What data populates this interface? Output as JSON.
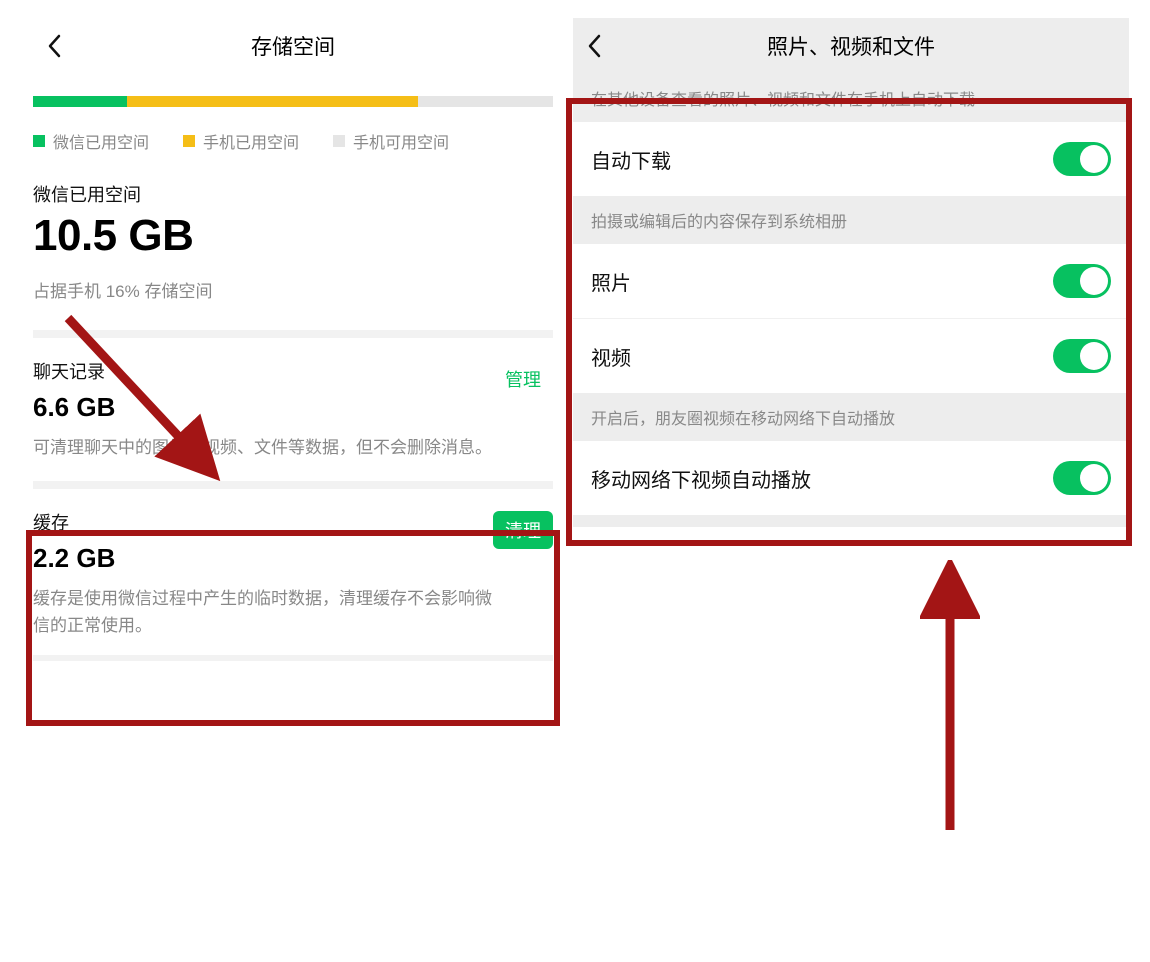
{
  "left": {
    "title": "存储空间",
    "progress": {
      "green_pct": 18,
      "yellow_pct": 56,
      "gray_pct": 26
    },
    "legend": {
      "wechat_used": "微信已用空间",
      "phone_used": "手机已用空间",
      "phone_free": "手机可用空间"
    },
    "wechat": {
      "label": "微信已用空间",
      "value": "10.5 GB",
      "sub": "占据手机 16% 存储空间"
    },
    "chat": {
      "label": "聊天记录",
      "value": "6.6 GB",
      "action": "管理",
      "desc": "可清理聊天中的图片、视频、文件等数据，但不会删除消息。"
    },
    "cache": {
      "label": "缓存",
      "value": "2.2 GB",
      "action": "清理",
      "desc": "缓存是使用微信过程中产生的临时数据，清理缓存不会影响微信的正常使用。"
    }
  },
  "right": {
    "title": "照片、视频和文件",
    "note_autodl": "在其他设备查看的照片、视频和文件在手机上自动下载",
    "item_autodl": "自动下载",
    "note_save": "拍摄或编辑后的内容保存到系统相册",
    "item_photo": "照片",
    "item_video": "视频",
    "note_autoplay": "开启后，朋友圈视频在移动网络下自动播放",
    "item_autoplay": "移动网络下视频自动播放"
  },
  "colors": {
    "green": "#07c160",
    "yellow": "#f5be17",
    "gray": "#e5e5e5",
    "red": "#a31515"
  }
}
